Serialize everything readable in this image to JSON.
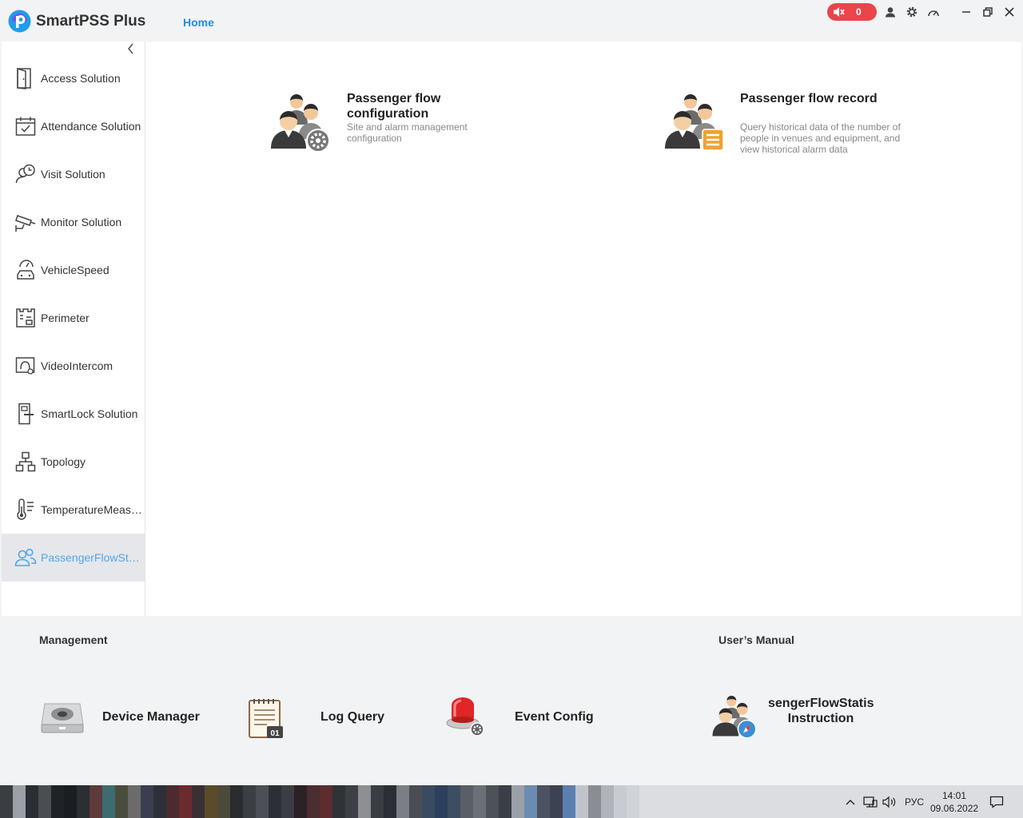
{
  "app": {
    "title": "SmartPSS Plus",
    "home_tab": "Home"
  },
  "header": {
    "alarm_count": "0",
    "alarm_color": "#e9454b"
  },
  "sidebar": {
    "items": [
      {
        "label": "Access Solution",
        "icon": "door-icon"
      },
      {
        "label": "Attendance Solution",
        "icon": "calendar-check-icon"
      },
      {
        "label": "Visit Solution",
        "icon": "visitor-clock-icon"
      },
      {
        "label": "Monitor Solution",
        "icon": "camera-icon"
      },
      {
        "label": "VehicleSpeed",
        "icon": "car-speed-icon"
      },
      {
        "label": "Perimeter",
        "icon": "perimeter-icon"
      },
      {
        "label": "VideoIntercom",
        "icon": "intercom-icon"
      },
      {
        "label": "SmartLock Solution",
        "icon": "smartlock-icon"
      },
      {
        "label": "Topology",
        "icon": "topology-icon"
      },
      {
        "label": "TemperatureMeasurement",
        "icon": "thermometer-icon"
      },
      {
        "label": "PassengerFlowStatistics",
        "icon": "people-icon"
      }
    ],
    "active_index": 10
  },
  "main": {
    "cards": [
      {
        "title": "Passenger flow configuration",
        "desc": "Site and alarm management configuration"
      },
      {
        "title": "Passenger flow record",
        "desc": "Query historical data of the number of people in venues and equipment, and view historical alarm data"
      }
    ]
  },
  "bottom": {
    "management_title": "Management",
    "manual_title": "User’s Manual",
    "tools": [
      {
        "label": "Device Manager"
      },
      {
        "label": "Log Query"
      },
      {
        "label": "Event Config"
      }
    ],
    "manual_line1": "sengerFlowStatis",
    "manual_line2": "Instruction"
  },
  "taskbar": {
    "language": "РУС",
    "time": "14:01",
    "date": "09.06.2022"
  }
}
